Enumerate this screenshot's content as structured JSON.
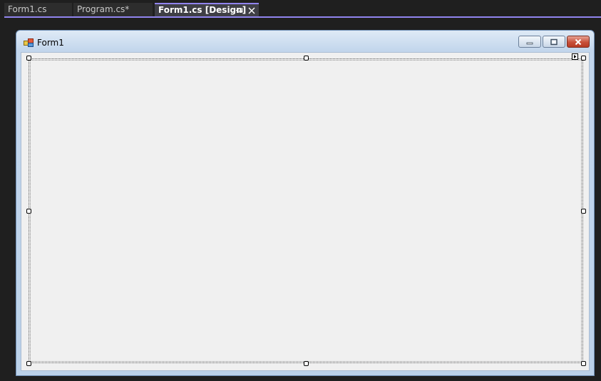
{
  "tabs": [
    {
      "label": "Form1.cs",
      "active": false
    },
    {
      "label": "Program.cs*",
      "active": false
    },
    {
      "label": "Form1.cs [Design]",
      "active": true
    }
  ],
  "active_tab_actions": {
    "pin_icon": "pin-icon",
    "close_icon": "close-icon"
  },
  "form": {
    "title": "Form1",
    "app_icon": "form-app-icon",
    "caption_buttons": [
      "minimize-icon",
      "maximize-icon",
      "close-icon"
    ]
  },
  "colors": {
    "ide_background": "#1f1f1f",
    "accent": "#9184ee",
    "form_client": "#f0f0f0",
    "titlebar": "#c3d6ec",
    "close_button": "#c8503a"
  }
}
